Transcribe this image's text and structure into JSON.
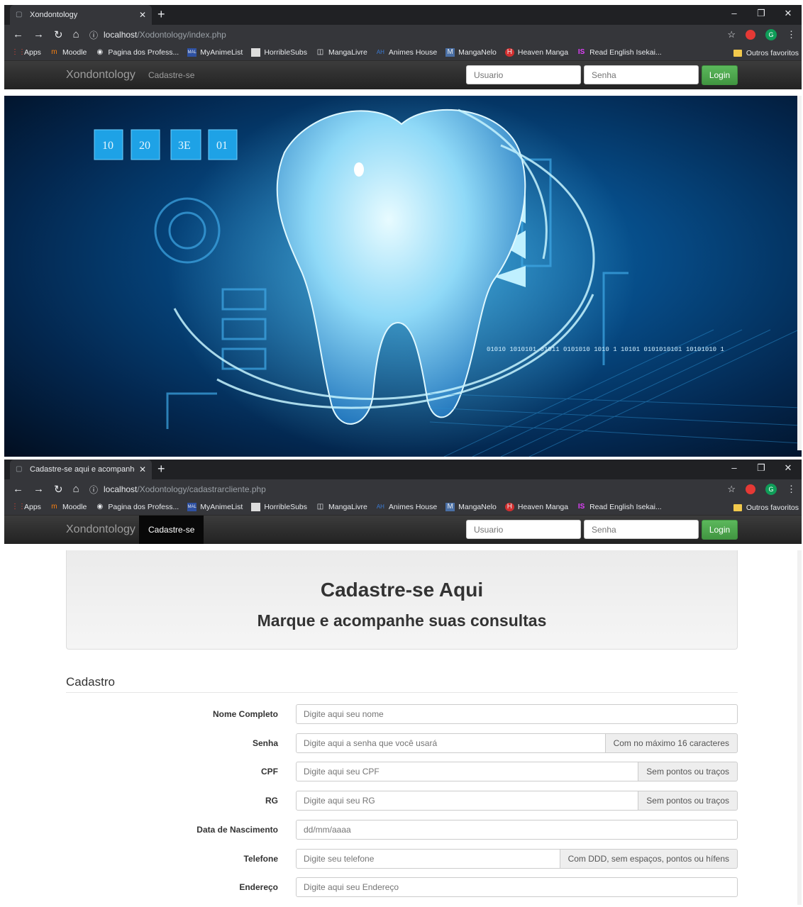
{
  "browser1": {
    "tab_title": "Xondontology",
    "url_host": "localhost",
    "url_path": "/Xodontology/index.php",
    "page": {
      "brand": "Xondontology",
      "nav_link": "Cadastre-se",
      "user_placeholder": "Usuario",
      "pass_placeholder": "Senha",
      "login_label": "Login"
    },
    "hero_icon": "tooth-technology-image"
  },
  "browser2": {
    "tab_title": "Cadastre-se aqui e acompanhe s",
    "url_host": "localhost",
    "url_path": "/Xodontology/cadastrarcliente.php",
    "page": {
      "brand": "Xondontology",
      "nav_link": "Cadastre-se",
      "user_placeholder": "Usuario",
      "pass_placeholder": "Senha",
      "login_label": "Login",
      "heading": "Cadastre-se Aqui",
      "subheading": "Marque e acompanhe suas consultas",
      "legend": "Cadastro",
      "fields": [
        {
          "label": "Nome Completo",
          "placeholder": "Digite aqui seu nome",
          "addon": ""
        },
        {
          "label": "Senha",
          "placeholder": "Digite aqui a senha que você usará",
          "addon": "Com no máximo 16 caracteres"
        },
        {
          "label": "CPF",
          "placeholder": "Digite aqui seu CPF",
          "addon": "Sem pontos ou traços"
        },
        {
          "label": "RG",
          "placeholder": "Digite aqui seu RG",
          "addon": "Sem pontos ou traços"
        },
        {
          "label": "Data de Nascimento",
          "placeholder": "dd/mm/aaaa",
          "addon": ""
        },
        {
          "label": "Telefone",
          "placeholder": "Digite seu telefone",
          "addon": "Com DDD, sem espaços, pontos ou hífens"
        },
        {
          "label": "Endereço",
          "placeholder": "Digite aqui seu Endereço",
          "addon": ""
        }
      ]
    }
  },
  "bookmarks": [
    "Apps",
    "Moodle",
    "Pagina dos Profess...",
    "MyAnimeList",
    "HorribleSubs",
    "MangaLivre",
    "Animes House",
    "MangaNelo",
    "Heaven Manga",
    "Read English Isekai..."
  ],
  "other_bookmarks": "Outros favoritos",
  "hero_text": {
    "boxes": [
      "10",
      "20",
      "3E",
      "01"
    ],
    "binary_line": "01010 1010101 01011 0101010 1010 1 10101 0101010101 10101010 1"
  }
}
